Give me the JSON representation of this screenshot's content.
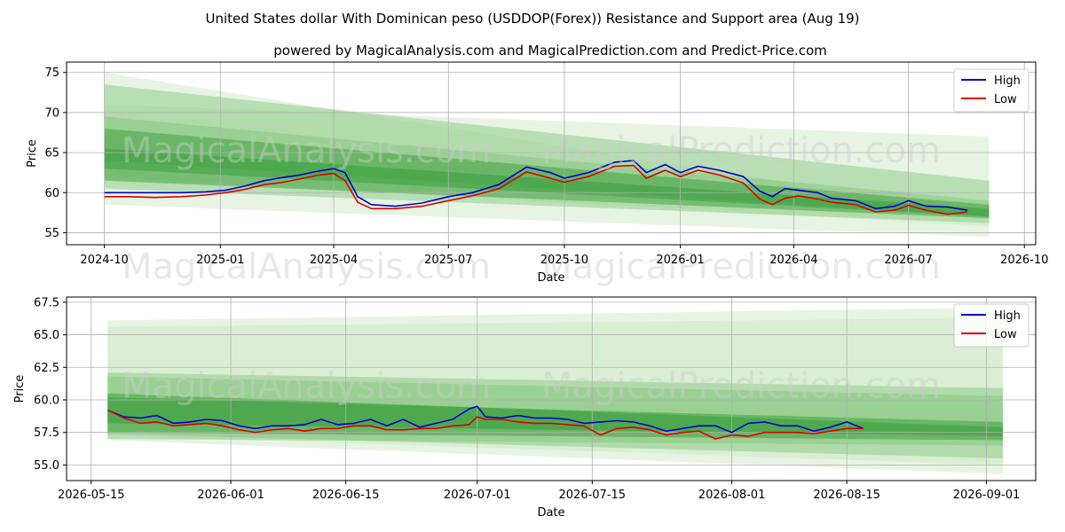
{
  "title": "United States dollar With Dominican peso (USDDOP(Forex)) Resistance and Support area (Aug 19)",
  "subtitle": "powered by MagicalAnalysis.com and MagicalPrediction.com and Predict-Price.com",
  "watermarks": [
    "MagicalAnalysis.com",
    "MagicalPrediction.com"
  ],
  "colors": {
    "high": "#0000cc",
    "low": "#dd0000",
    "band_light": "#c9e6c2",
    "band_mid": "#7fc377",
    "band_dark": "#2e9930",
    "grid": "#b0b0b0"
  },
  "chart_data": [
    {
      "type": "line",
      "xlabel": "Date",
      "ylabel": "Price",
      "x_range": [
        "2024-09-01",
        "2026-10-10"
      ],
      "ylim": [
        53.5,
        76.3
      ],
      "x_ticks": [
        "2024-10",
        "2025-01",
        "2025-04",
        "2025-07",
        "2025-10",
        "2026-01",
        "2026-04",
        "2026-07",
        "2026-10"
      ],
      "y_ticks": [
        55,
        60,
        65,
        70,
        75
      ],
      "legend": {
        "placement": "top-right",
        "entries": [
          "High",
          "Low"
        ]
      },
      "grid": true,
      "bands": [
        {
          "x": [
            "2024-10-01",
            "2026-09-03"
          ],
          "upper": [
            75.0,
            57.2
          ],
          "lower": [
            62.0,
            55.8
          ],
          "color": "band_light"
        },
        {
          "x": [
            "2024-10-01",
            "2026-09-03"
          ],
          "upper": [
            71.0,
            67.0
          ],
          "lower": [
            58.5,
            54.5
          ],
          "color": "band_light"
        },
        {
          "x": [
            "2024-10-01",
            "2026-09-03"
          ],
          "upper": [
            73.5,
            61.5
          ],
          "lower": [
            64.0,
            57.0
          ],
          "color": "band_mid"
        },
        {
          "x": [
            "2024-10-01",
            "2026-09-03"
          ],
          "upper": [
            69.5,
            59.0
          ],
          "lower": [
            60.5,
            56.2
          ],
          "color": "band_mid"
        },
        {
          "x": [
            "2024-10-01",
            "2026-09-03"
          ],
          "upper": [
            68.0,
            58.5
          ],
          "lower": [
            63.0,
            57.0
          ],
          "color": "band_dark"
        },
        {
          "x": [
            "2024-10-01",
            "2026-09-03"
          ],
          "upper": [
            65.5,
            58.0
          ],
          "lower": [
            61.5,
            56.8
          ],
          "color": "band_dark"
        }
      ],
      "series": [
        {
          "name": "High",
          "color": "high",
          "x": [
            "2024-10-01",
            "2024-10-20",
            "2024-11-10",
            "2024-12-01",
            "2024-12-20",
            "2025-01-05",
            "2025-01-20",
            "2025-02-05",
            "2025-02-20",
            "2025-03-05",
            "2025-03-20",
            "2025-04-01",
            "2025-04-10",
            "2025-04-20",
            "2025-05-01",
            "2025-05-20",
            "2025-06-10",
            "2025-07-01",
            "2025-07-20",
            "2025-08-10",
            "2025-09-01",
            "2025-09-20",
            "2025-10-01",
            "2025-10-20",
            "2025-11-10",
            "2025-11-25",
            "2025-12-05",
            "2025-12-20",
            "2026-01-01",
            "2026-01-15",
            "2026-02-01",
            "2026-02-20",
            "2026-03-05",
            "2026-03-15",
            "2026-03-25",
            "2026-04-05",
            "2026-04-20",
            "2026-05-01",
            "2026-05-20",
            "2026-06-05",
            "2026-06-20",
            "2026-07-01",
            "2026-07-15",
            "2026-08-01",
            "2026-08-17"
          ],
          "y": [
            60.0,
            60.0,
            60.0,
            60.0,
            60.1,
            60.3,
            60.8,
            61.5,
            61.9,
            62.2,
            62.7,
            63.0,
            62.5,
            59.5,
            58.5,
            58.3,
            58.7,
            59.5,
            60.0,
            61.0,
            63.2,
            62.5,
            61.8,
            62.5,
            63.8,
            64.0,
            62.5,
            63.5,
            62.5,
            63.3,
            62.8,
            62.0,
            60.2,
            59.5,
            60.5,
            60.3,
            60.0,
            59.3,
            59.0,
            58.0,
            58.3,
            59.0,
            58.3,
            58.2,
            57.8
          ]
        },
        {
          "name": "Low",
          "color": "low",
          "x": [
            "2024-10-01",
            "2024-10-20",
            "2024-11-10",
            "2024-12-01",
            "2024-12-20",
            "2025-01-05",
            "2025-01-20",
            "2025-02-05",
            "2025-02-20",
            "2025-03-05",
            "2025-03-20",
            "2025-04-01",
            "2025-04-10",
            "2025-04-20",
            "2025-05-01",
            "2025-05-20",
            "2025-06-10",
            "2025-07-01",
            "2025-07-20",
            "2025-08-10",
            "2025-09-01",
            "2025-09-20",
            "2025-10-01",
            "2025-10-20",
            "2025-11-10",
            "2025-11-25",
            "2025-12-05",
            "2025-12-20",
            "2026-01-01",
            "2026-01-15",
            "2026-02-01",
            "2026-02-20",
            "2026-03-05",
            "2026-03-15",
            "2026-03-25",
            "2026-04-05",
            "2026-04-20",
            "2026-05-01",
            "2026-05-20",
            "2026-06-05",
            "2026-06-20",
            "2026-07-01",
            "2026-07-15",
            "2026-08-01",
            "2026-08-17"
          ],
          "y": [
            59.5,
            59.5,
            59.4,
            59.5,
            59.7,
            60.0,
            60.4,
            61.0,
            61.3,
            61.7,
            62.2,
            62.4,
            61.5,
            58.8,
            58.0,
            58.0,
            58.3,
            59.0,
            59.6,
            60.5,
            62.6,
            61.8,
            61.3,
            62.0,
            63.3,
            63.4,
            61.8,
            62.8,
            62.0,
            62.8,
            62.2,
            61.2,
            59.2,
            58.5,
            59.3,
            59.6,
            59.2,
            58.8,
            58.5,
            57.6,
            57.8,
            58.4,
            57.8,
            57.3,
            57.6
          ]
        }
      ]
    },
    {
      "type": "line",
      "xlabel": "Date",
      "ylabel": "Price",
      "x_range": [
        "2026-05-12",
        "2026-09-07"
      ],
      "ylim": [
        53.8,
        67.9
      ],
      "x_ticks": [
        "2026-05-15",
        "2026-06-01",
        "2026-06-15",
        "2026-07-01",
        "2026-07-15",
        "2026-08-01",
        "2026-08-15",
        "2026-09-01"
      ],
      "y_ticks": [
        55.0,
        57.5,
        60.0,
        62.5,
        65.0,
        67.5
      ],
      "legend": {
        "placement": "top-right",
        "entries": [
          "High",
          "Low"
        ]
      },
      "grid": true,
      "bands": [
        {
          "x": [
            "2026-05-17",
            "2026-09-03"
          ],
          "upper": [
            66.1,
            67.1
          ],
          "lower": [
            56.9,
            54.3
          ],
          "color": "band_light"
        },
        {
          "x": [
            "2026-05-17",
            "2026-09-03"
          ],
          "upper": [
            65.6,
            66.3
          ],
          "lower": [
            57.3,
            55.0
          ],
          "color": "band_light"
        },
        {
          "x": [
            "2026-05-17",
            "2026-09-03"
          ],
          "upper": [
            62.1,
            60.9
          ],
          "lower": [
            57.4,
            55.5
          ],
          "color": "band_mid"
        },
        {
          "x": [
            "2026-05-17",
            "2026-09-03"
          ],
          "upper": [
            61.8,
            60.3
          ],
          "lower": [
            57.0,
            56.5
          ],
          "color": "band_mid"
        },
        {
          "x": [
            "2026-05-17",
            "2026-09-03"
          ],
          "upper": [
            60.5,
            57.9
          ],
          "lower": [
            57.5,
            56.9
          ],
          "color": "band_dark"
        },
        {
          "x": [
            "2026-05-17",
            "2026-09-03"
          ],
          "upper": [
            60.2,
            58.3
          ],
          "lower": [
            58.2,
            57.2
          ],
          "color": "band_dark"
        }
      ],
      "series": [
        {
          "name": "High",
          "color": "high",
          "x": [
            "2026-05-17",
            "2026-05-19",
            "2026-05-21",
            "2026-05-23",
            "2026-05-25",
            "2026-05-27",
            "2026-05-29",
            "2026-05-31",
            "2026-06-02",
            "2026-06-04",
            "2026-06-06",
            "2026-06-08",
            "2026-06-10",
            "2026-06-12",
            "2026-06-14",
            "2026-06-16",
            "2026-06-18",
            "2026-06-20",
            "2026-06-22",
            "2026-06-24",
            "2026-06-26",
            "2026-06-28",
            "2026-06-30",
            "2026-07-01",
            "2026-07-02",
            "2026-07-04",
            "2026-07-06",
            "2026-07-08",
            "2026-07-10",
            "2026-07-12",
            "2026-07-14",
            "2026-07-16",
            "2026-07-18",
            "2026-07-20",
            "2026-07-22",
            "2026-07-24",
            "2026-07-26",
            "2026-07-28",
            "2026-07-30",
            "2026-08-01",
            "2026-08-03",
            "2026-08-05",
            "2026-08-07",
            "2026-08-09",
            "2026-08-11",
            "2026-08-13",
            "2026-08-15",
            "2026-08-17"
          ],
          "y": [
            59.2,
            58.7,
            58.6,
            58.8,
            58.2,
            58.3,
            58.5,
            58.4,
            58.0,
            57.8,
            58.0,
            58.0,
            58.1,
            58.5,
            58.1,
            58.2,
            58.5,
            58.0,
            58.5,
            57.9,
            58.2,
            58.5,
            59.3,
            59.5,
            58.7,
            58.6,
            58.8,
            58.6,
            58.6,
            58.5,
            58.2,
            58.3,
            58.4,
            58.3,
            58.0,
            57.6,
            57.8,
            58.0,
            58.0,
            57.5,
            58.2,
            58.3,
            58.0,
            58.0,
            57.6,
            57.9,
            58.3,
            57.8
          ]
        },
        {
          "name": "Low",
          "color": "low",
          "x": [
            "2026-05-17",
            "2026-05-19",
            "2026-05-21",
            "2026-05-23",
            "2026-05-25",
            "2026-05-27",
            "2026-05-29",
            "2026-05-31",
            "2026-06-02",
            "2026-06-04",
            "2026-06-06",
            "2026-06-08",
            "2026-06-10",
            "2026-06-12",
            "2026-06-14",
            "2026-06-16",
            "2026-06-18",
            "2026-06-20",
            "2026-06-22",
            "2026-06-24",
            "2026-06-26",
            "2026-06-28",
            "2026-06-30",
            "2026-07-01",
            "2026-07-02",
            "2026-07-04",
            "2026-07-06",
            "2026-07-08",
            "2026-07-10",
            "2026-07-12",
            "2026-07-14",
            "2026-07-16",
            "2026-07-18",
            "2026-07-20",
            "2026-07-22",
            "2026-07-24",
            "2026-07-26",
            "2026-07-28",
            "2026-07-30",
            "2026-08-01",
            "2026-08-03",
            "2026-08-05",
            "2026-08-07",
            "2026-08-09",
            "2026-08-11",
            "2026-08-13",
            "2026-08-15",
            "2026-08-17"
          ],
          "y": [
            59.2,
            58.6,
            58.2,
            58.3,
            58.0,
            58.1,
            58.2,
            58.0,
            57.7,
            57.5,
            57.7,
            57.8,
            57.6,
            57.8,
            57.8,
            58.0,
            58.0,
            57.7,
            57.7,
            57.8,
            57.8,
            58.0,
            58.1,
            58.7,
            58.5,
            58.5,
            58.3,
            58.2,
            58.2,
            58.1,
            58.0,
            57.3,
            57.8,
            57.9,
            57.7,
            57.3,
            57.5,
            57.6,
            57.0,
            57.3,
            57.2,
            57.5,
            57.5,
            57.5,
            57.4,
            57.6,
            57.8,
            57.8
          ]
        }
      ]
    }
  ]
}
